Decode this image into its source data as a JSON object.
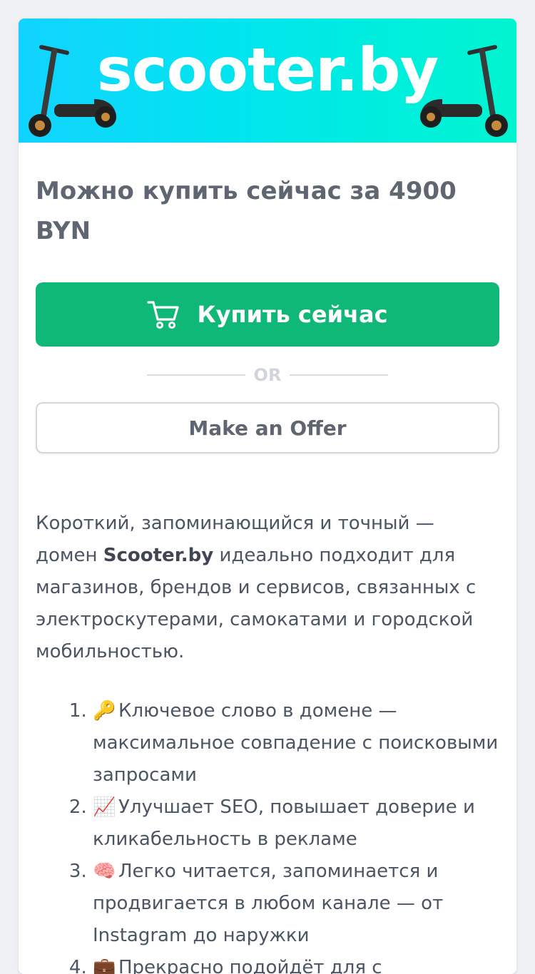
{
  "banner": {
    "logo_text": "scooter.by",
    "colors": {
      "gradient_start": "#12d3ff",
      "gradient_end": "#00f5cf"
    }
  },
  "price": {
    "title": "Можно купить сейчас за 4900 BYN"
  },
  "actions": {
    "buy_label": "Купить сейчас",
    "buy_icon": "cart-icon",
    "or_label": "OR",
    "offer_label": "Make an Offer",
    "colors": {
      "buy_button": "#10b878"
    }
  },
  "description": {
    "before": "Короткий, запоминающийся и точный — домен ",
    "domain": "Scooter.by",
    "after": " идеально подходит для магазинов, брендов и сервисов, связанных с электроскутерами, самокатами и городской мобильностью."
  },
  "features": [
    {
      "emoji": "🔑",
      "text": "Ключевое слово в домене — максимальное совпадение с поисковыми запросами"
    },
    {
      "emoji": "📈",
      "text": "Улучшает SEO, повышает доверие и кликабельность в рекламе"
    },
    {
      "emoji": "🧠",
      "text": "Легко читается, запоминается и продвигается в любом канале — от Instagram до наружки"
    },
    {
      "emoji": "💼",
      "text": "Прекрасно подойдёт для с"
    }
  ]
}
